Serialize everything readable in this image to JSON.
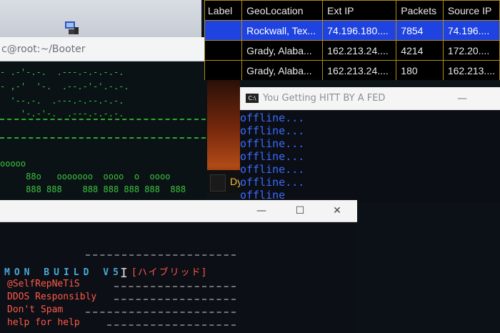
{
  "booter_terminal": {
    "title": "c@root:~/Booter",
    "ascii_rows": [
      "- .-'-.-.  .---.-.-.-.-.",
      "- ,-'  '-.  .--.-'-'.-.-.",
      "  '--.-.  .---.-.--.-.-.",
      "    '-.-'-.  .---.-.-.-.",
      "ooooo",
      "     88o   ooooooo  oooo  o  oooo",
      "     888 888    888 888 888 888  888"
    ]
  },
  "connection_table": {
    "columns": [
      "Label",
      "GeoLocation",
      "Ext IP",
      "Packets",
      "Source IP"
    ],
    "rows": [
      {
        "label": "",
        "geo": "Rockwall, Tex...",
        "ext_ip": "74.196.180....",
        "packets": "7854",
        "source_ip": "74.196....",
        "selected": true
      },
      {
        "label": "",
        "geo": "Grady, Alaba...",
        "ext_ip": "162.213.24....",
        "packets": "4214",
        "source_ip": "172.20....",
        "selected": false
      },
      {
        "label": "",
        "geo": "Grady, Alaba...",
        "ext_ip": "162.213.24....",
        "packets": "180",
        "source_ip": "162.213....",
        "selected": false
      }
    ]
  },
  "background_panel": {
    "label": "Dy"
  },
  "fed_console": {
    "title": "You Getting HITT BY A FED",
    "icon": "cmd-icon",
    "lines": [
      "offline...",
      "offline...",
      "offline...",
      "offline...",
      "offline...",
      "offline...",
      "offline"
    ]
  },
  "main_console": {
    "buttons": {
      "minimize": "—",
      "maximize": "☐",
      "close": "✕"
    },
    "banner": "MON BUILD V5",
    "banner_jp": "[ハイブリッド]",
    "lines": [
      "@SelfRepNeTiS",
      "DDOS Responsibly",
      "Don't Spam",
      "help for help"
    ]
  },
  "colors": {
    "terminal_green": "#3cc23c",
    "selection_blue": "#1f43e0",
    "offline_blue": "#3b6cff",
    "banner_cyan": "#4aa8d8",
    "console_red": "#ff5a4a",
    "table_grid": "#b08a18"
  }
}
